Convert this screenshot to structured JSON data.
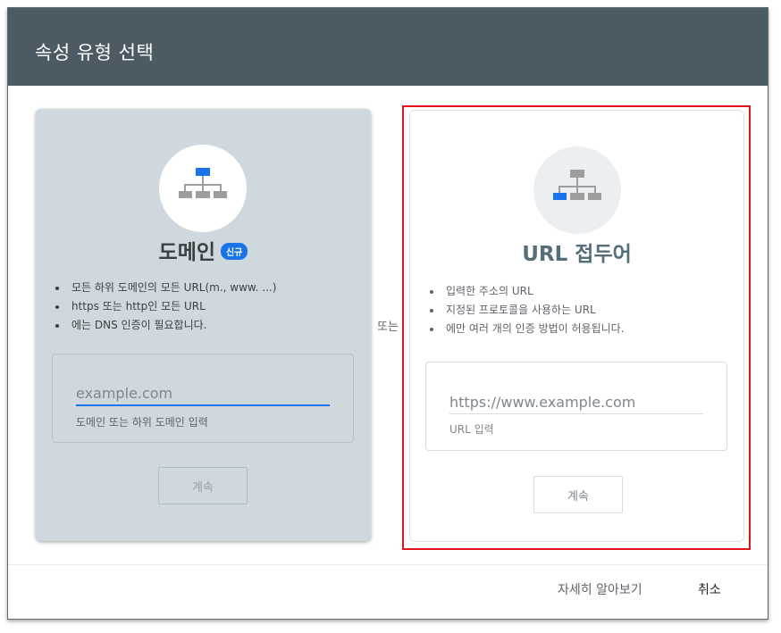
{
  "dialog": {
    "title": "속성 유형 선택"
  },
  "domain_card": {
    "icon": "sitemap-icon",
    "title": "도메인",
    "badge": "신규",
    "bullets": [
      "모든 하위 도메인의 모든 URL(m., www. ...)",
      "https 또는 http인 모든 URL",
      "에는 DNS 인증이 필요합니다."
    ],
    "input_placeholder": "example.com",
    "input_value": "",
    "helper": "도메인 또는 하위 도메인 입력",
    "continue_label": "계속"
  },
  "or_label": "또는",
  "url_card": {
    "icon": "sitemap-icon",
    "title": "URL 접두어",
    "bullets": [
      "입력한 주소의 URL",
      "지정된 프로토콜을 사용하는 URL",
      "에만 여러 개의 인증 방법이 허용됩니다."
    ],
    "input_placeholder": "https://www.example.com",
    "input_value": "",
    "helper": "URL 입력",
    "continue_label": "계속"
  },
  "footer": {
    "learn_more_label": "자세히 알아보기",
    "cancel_label": "취소"
  },
  "colors": {
    "header": "#4b5a63",
    "domain_card_bg": "#cfd8dc",
    "accent_blue": "#1a73e8",
    "highlight_red": "#e3131c"
  }
}
